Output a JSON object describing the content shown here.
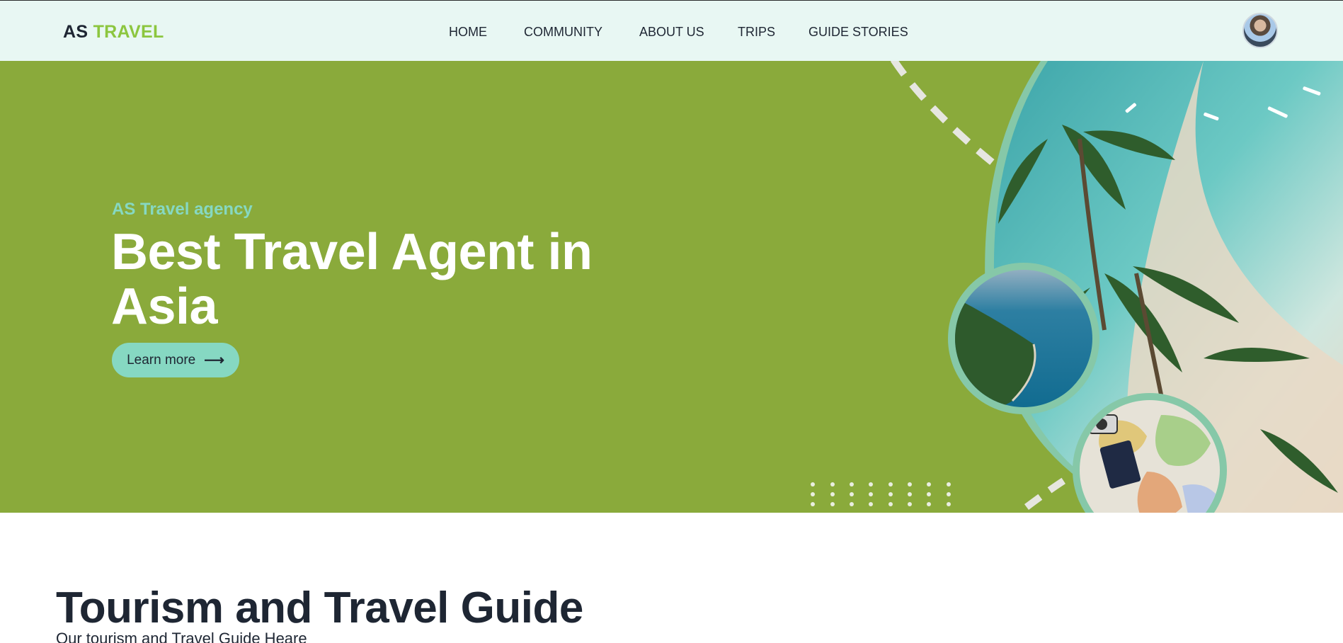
{
  "brand": {
    "part1": "AS",
    "part2": "TRAVEL"
  },
  "nav": {
    "items": [
      "HOME",
      "COMMUNITY",
      "ABOUT US",
      "TRIPS",
      "GUIDE STORIES"
    ]
  },
  "hero": {
    "subtitle": "AS Travel agency",
    "title": "Best Travel Agent in Asia",
    "cta_label": "Learn more",
    "cta_icon": "arrow-right-icon"
  },
  "section": {
    "title": "Tourism and Travel Guide",
    "subtitle": "Our tourism and Travel Guide Heare"
  },
  "colors": {
    "header_bg": "#e8f7f3",
    "hero_bg": "#8aaa3b",
    "accent_mint": "#86d8c2",
    "brand_green": "#8cc63f",
    "text_dark": "#1e2633"
  }
}
